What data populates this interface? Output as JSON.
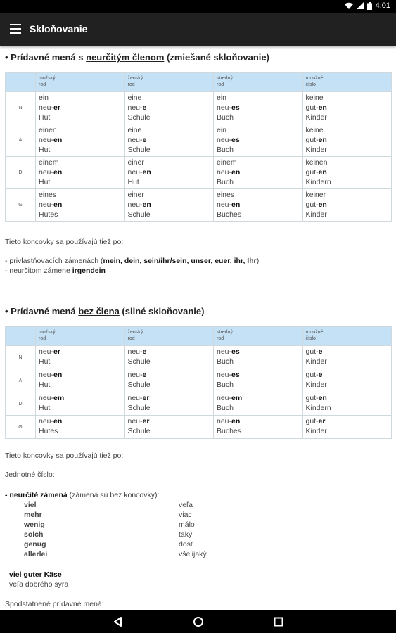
{
  "status": {
    "time": "4:01"
  },
  "appbar": {
    "title": "Skloňovanie"
  },
  "section1": {
    "bullet": "•",
    "pre": " Prídavné mená s ",
    "underlined": "neurčitým členom",
    "post": " (zmiešané skloňovanie)",
    "headers": [
      {
        "line1": "",
        "line2": ""
      },
      {
        "line1": "mužský",
        "line2": "rod"
      },
      {
        "line1": "ženský",
        "line2": "rod"
      },
      {
        "line1": "stredný",
        "line2": "rod"
      },
      {
        "line1": "množné",
        "line2": "číslo"
      }
    ],
    "rows": [
      {
        "case": "N",
        "cells": [
          {
            "art": "ein",
            "stem": "neu-",
            "end": "er",
            "noun": "Hut"
          },
          {
            "art": "eine",
            "stem": "neu-",
            "end": "e",
            "noun": "Schule"
          },
          {
            "art": "ein",
            "stem": "neu-",
            "end": "es",
            "noun": "Buch"
          },
          {
            "art": "keine",
            "stem": "gut-",
            "end": "en",
            "noun": "Kinder"
          }
        ]
      },
      {
        "case": "A",
        "cells": [
          {
            "art": "einen",
            "stem": "neu-",
            "end": "en",
            "noun": "Hut"
          },
          {
            "art": "eine",
            "stem": "neu-",
            "end": "e",
            "noun": "Schule"
          },
          {
            "art": "ein",
            "stem": "neu-",
            "end": "es",
            "noun": "Buch"
          },
          {
            "art": "keine",
            "stem": "gut-",
            "end": "en",
            "noun": "Kinder"
          }
        ]
      },
      {
        "case": "D",
        "cells": [
          {
            "art": "einem",
            "stem": "neu-",
            "end": "en",
            "noun": "Hut"
          },
          {
            "art": "einer",
            "stem": "neu-",
            "end": "en",
            "noun": "Hut"
          },
          {
            "art": "einem",
            "stem": "neu-",
            "end": "en",
            "noun": "Buch"
          },
          {
            "art": "keinen",
            "stem": "gut-",
            "end": "en",
            "noun": "Kindern"
          }
        ]
      },
      {
        "case": "G",
        "cells": [
          {
            "art": "eines",
            "stem": "neu-",
            "end": "en",
            "noun": "Hutes"
          },
          {
            "art": "einer",
            "stem": "neu-",
            "end": "en",
            "noun": "Schule"
          },
          {
            "art": "eines",
            "stem": "neu-",
            "end": "en",
            "noun": "Buches"
          },
          {
            "art": "keiner",
            "stem": "gut-",
            "end": "en",
            "noun": "Kinder"
          }
        ]
      }
    ],
    "note_intro": "Tieto koncovky sa používajú tiež po:",
    "note_line1_pre": "- privlastňovacích zámenách (",
    "note_line1_bold": "mein, dein, sein/ihr/sein, unser, euer, ihr, Ihr",
    "note_line1_post": ")",
    "note_line2_pre": "- neurčitom zámene ",
    "note_line2_bold": "irgendein"
  },
  "section2": {
    "bullet": "•",
    "pre": " Prídavné mená ",
    "underlined": "bez člena",
    "post": " (silné skloňovanie)",
    "headers": [
      {
        "line1": "",
        "line2": ""
      },
      {
        "line1": "mužský",
        "line2": "rod"
      },
      {
        "line1": "ženský",
        "line2": "rod"
      },
      {
        "line1": "stredný",
        "line2": "rod"
      },
      {
        "line1": "množné",
        "line2": "číslo"
      }
    ],
    "rows": [
      {
        "case": "N",
        "cells": [
          {
            "stem": "neu-",
            "end": "er",
            "noun": "Hut"
          },
          {
            "stem": "neu-",
            "end": "e",
            "noun": "Schule"
          },
          {
            "stem": "neu-",
            "end": "es",
            "noun": "Buch"
          },
          {
            "stem": "gut-",
            "end": "e",
            "noun": "Kinder"
          }
        ]
      },
      {
        "case": "A",
        "cells": [
          {
            "stem": "neu-",
            "end": "en",
            "noun": "Hut"
          },
          {
            "stem": "neu-",
            "end": "e",
            "noun": "Schule"
          },
          {
            "stem": "neu-",
            "end": "es",
            "noun": "Buch"
          },
          {
            "stem": "gut-",
            "end": "e",
            "noun": "Kinder"
          }
        ]
      },
      {
        "case": "D",
        "cells": [
          {
            "stem": "neu-",
            "end": "em",
            "noun": "Hut"
          },
          {
            "stem": "neu-",
            "end": "er",
            "noun": "Schule"
          },
          {
            "stem": "neu-",
            "end": "em",
            "noun": "Buch"
          },
          {
            "stem": "gut-",
            "end": "en",
            "noun": "Kindern"
          }
        ]
      },
      {
        "case": "G",
        "cells": [
          {
            "stem": "neu-",
            "end": "en",
            "noun": "Hutes"
          },
          {
            "stem": "neu-",
            "end": "er",
            "noun": "Schule"
          },
          {
            "stem": "neu-",
            "end": "en",
            "noun": "Buches"
          },
          {
            "stem": "gut-",
            "end": "er",
            "noun": "Kinder"
          }
        ]
      }
    ],
    "note_intro": "Tieto koncovky sa používajú tiež po:",
    "singular_label": "Jednotné číslo:",
    "pron_bold": "- neurčité zámená",
    "pron_rest": " (zámená sú bez koncovky):",
    "pronouns": [
      {
        "de": "viel",
        "sk": "veľa"
      },
      {
        "de": "mehr",
        "sk": "viac"
      },
      {
        "de": "wenig",
        "sk": "málo"
      },
      {
        "de": "solch",
        "sk": "taký"
      },
      {
        "de": "genug",
        "sk": "dosť"
      },
      {
        "de": "allerlei",
        "sk": "všelijaký"
      }
    ],
    "example_de": "viel guter Käse",
    "example_sk": "veľa dobrého syra",
    "nominal_label": "Spodstatnené prídavné mená:"
  }
}
